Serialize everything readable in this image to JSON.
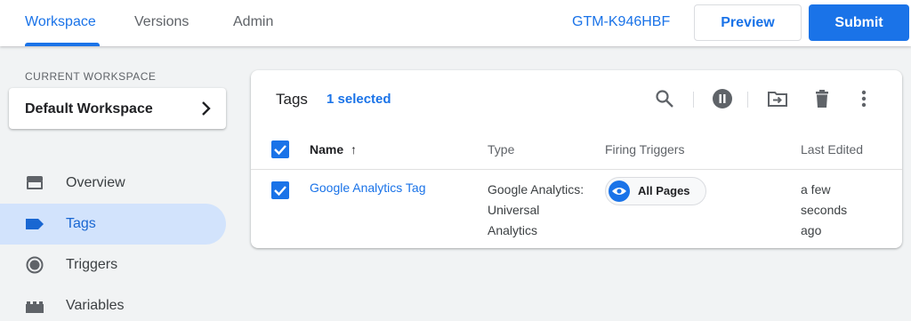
{
  "header": {
    "tabs": [
      {
        "label": "Workspace",
        "active": true
      },
      {
        "label": "Versions",
        "active": false
      },
      {
        "label": "Admin",
        "active": false
      }
    ],
    "container_id": "GTM-K946HBF",
    "preview_label": "Preview",
    "submit_label": "Submit"
  },
  "sidebar": {
    "workspace_section_label": "CURRENT WORKSPACE",
    "workspace_name": "Default Workspace",
    "items": [
      {
        "label": "Overview",
        "icon": "overview-icon",
        "active": false
      },
      {
        "label": "Tags",
        "icon": "tag-icon",
        "active": true
      },
      {
        "label": "Triggers",
        "icon": "trigger-icon",
        "active": false
      },
      {
        "label": "Variables",
        "icon": "variables-icon",
        "active": false
      }
    ]
  },
  "main": {
    "title": "Tags",
    "selected_text": "1 selected",
    "toolbar": [
      "search-icon",
      "pause-icon",
      "move-to-folder-icon",
      "delete-icon",
      "more-vert-icon"
    ],
    "columns": {
      "name": "Name",
      "sort_arrow": "↑",
      "type": "Type",
      "firing_triggers": "Firing Triggers",
      "last_edited": "Last Edited"
    },
    "rows": [
      {
        "selected": true,
        "name": "Google Analytics Tag",
        "type_lines": [
          "Google Analytics:",
          "Universal",
          "Analytics"
        ],
        "trigger": "All Pages",
        "last_edited_lines": [
          "a few",
          "seconds",
          "ago"
        ]
      }
    ]
  },
  "colors": {
    "accent": "#1a73e8",
    "active_nav_bg": "#d2e3fc",
    "background": "#f1f3f4"
  }
}
